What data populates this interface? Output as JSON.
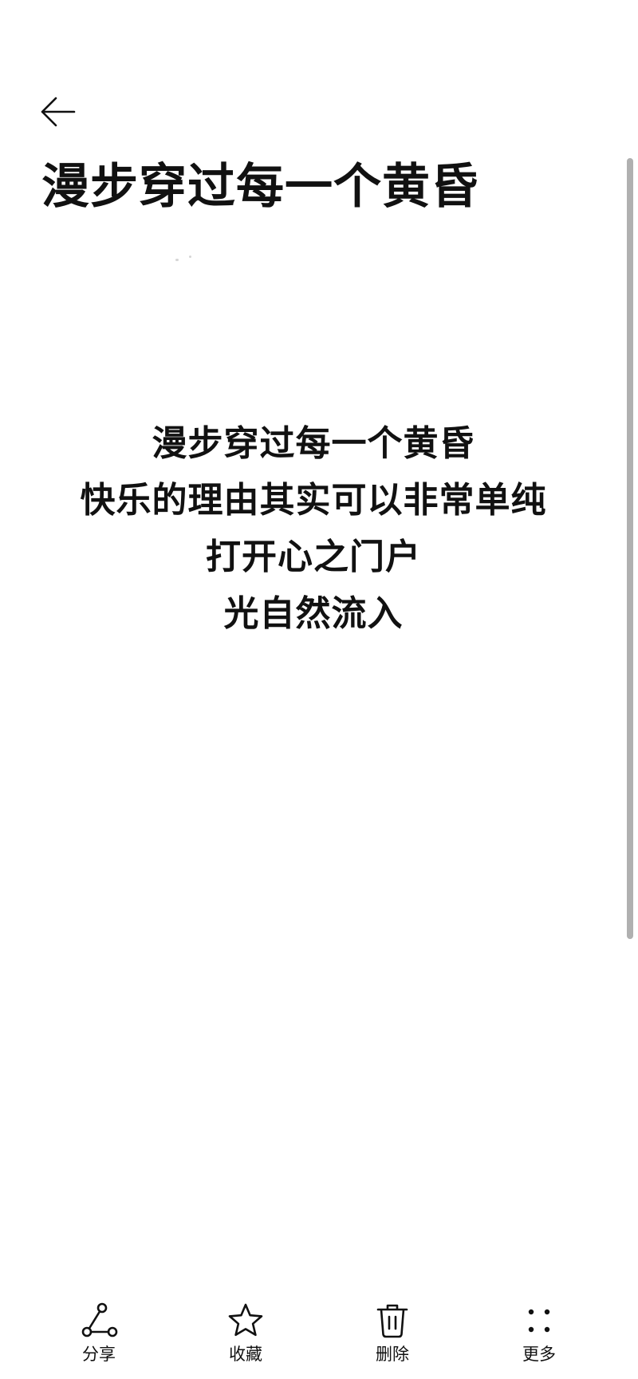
{
  "header": {
    "back_icon": "arrow-left-icon",
    "title": "漫步穿过每一个黄昏"
  },
  "content": {
    "lines": [
      "漫步穿过每一个黄昏",
      "快乐的理由其实可以非常单纯",
      "打开心之门户",
      "光自然流入"
    ]
  },
  "toolbar": {
    "share": {
      "label": "分享",
      "icon": "share-icon"
    },
    "favorite": {
      "label": "收藏",
      "icon": "star-icon"
    },
    "delete": {
      "label": "删除",
      "icon": "trash-icon"
    },
    "more": {
      "label": "更多",
      "icon": "more-dots-icon"
    }
  }
}
